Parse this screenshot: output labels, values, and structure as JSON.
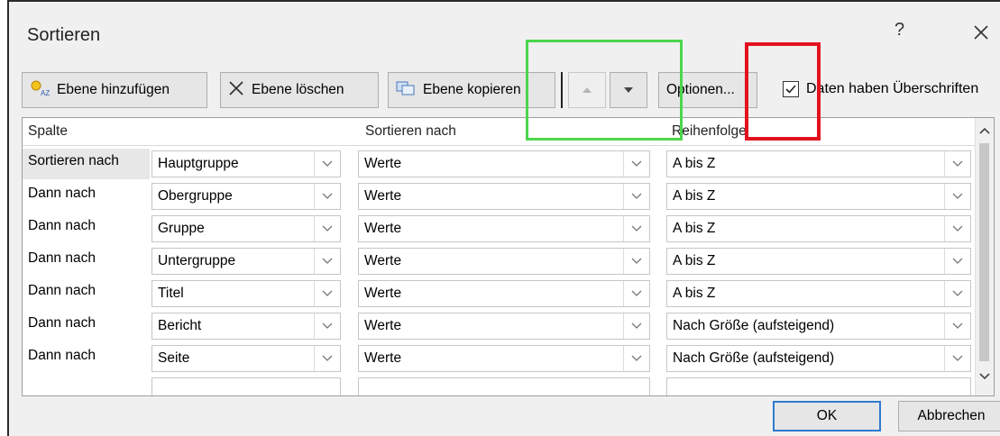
{
  "window": {
    "title": "Sortieren",
    "help": "?"
  },
  "toolbar": {
    "add_level": "Ebene hinzufügen",
    "delete_level": "Ebene löschen",
    "copy_level": "Ebene kopieren",
    "options": "Optionen...",
    "has_headers_label": "Daten haben Überschriften",
    "has_headers_checked": true
  },
  "grid": {
    "headers": {
      "column": "Spalte",
      "sort_on": "Sortieren nach",
      "order": "Reihenfolge"
    },
    "rows": [
      {
        "label": "Sortieren nach",
        "column": "Hauptgruppe",
        "sort_on": "Werte",
        "order": "A bis Z"
      },
      {
        "label": "Dann nach",
        "column": "Obergruppe",
        "sort_on": "Werte",
        "order": "A bis Z"
      },
      {
        "label": "Dann nach",
        "column": "Gruppe",
        "sort_on": "Werte",
        "order": "A bis Z"
      },
      {
        "label": "Dann nach",
        "column": "Untergruppe",
        "sort_on": "Werte",
        "order": "A bis Z"
      },
      {
        "label": "Dann nach",
        "column": "Titel",
        "sort_on": "Werte",
        "order": "A bis Z"
      },
      {
        "label": "Dann nach",
        "column": "Bericht",
        "sort_on": "Werte",
        "order": "Nach Größe (aufsteigend)"
      },
      {
        "label": "Dann nach",
        "column": "Seite",
        "sort_on": "Werte",
        "order": "Nach Größe (aufsteigend)"
      }
    ]
  },
  "footer": {
    "ok": "OK",
    "cancel": "Abbrechen"
  },
  "colors": {
    "highlight_green": "#4cd64c",
    "highlight_red": "#e3121f",
    "ok_border": "#2f7ad0"
  }
}
